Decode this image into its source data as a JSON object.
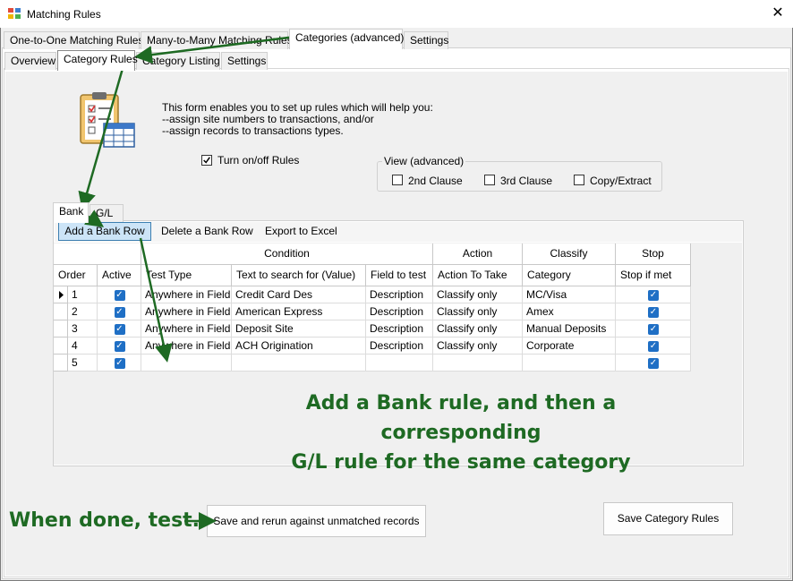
{
  "window": {
    "title": "Matching Rules",
    "close_glyph": "✕"
  },
  "main_tabs": [
    "One-to-One Matching Rules",
    "Many-to-Many Matching Rules",
    "Categories (advanced)",
    "Settings"
  ],
  "sub_tabs": [
    "Overview",
    "Category Rules",
    "Category Listing",
    "Settings"
  ],
  "intro": {
    "line1": "This form enables you to set up rules which will help you:",
    "line2": "--assign site numbers to transactions, and/or",
    "line3": "--assign records to transactions types."
  },
  "turn_onoff": {
    "label": "Turn on/off Rules",
    "checked": true
  },
  "view_adv": {
    "legend": "View (advanced)",
    "options": [
      "2nd Clause",
      "3rd Clause",
      "Copy/Extract"
    ]
  },
  "grid_tabs": [
    "Bank",
    "G/L"
  ],
  "toolbar": {
    "add": "Add a Bank Row",
    "delete": "Delete a Bank Row",
    "export": "Export to Excel"
  },
  "group_headers": {
    "condition": "Condition",
    "action": "Action",
    "classify": "Classify",
    "stop": "Stop"
  },
  "columns": [
    "Order",
    "Active",
    "Test Type",
    "Text to search for (Value)",
    "Field to test",
    "Action To Take",
    "Category",
    "Stop if met"
  ],
  "rows": [
    {
      "order": "1",
      "test": "Anywhere in Field",
      "text": "Credit Card Des",
      "field": "Description",
      "action": "Classify only",
      "category": "MC/Visa"
    },
    {
      "order": "2",
      "test": "Anywhere in Field",
      "text": "American Express",
      "field": "Description",
      "action": "Classify only",
      "category": "Amex"
    },
    {
      "order": "3",
      "test": "Anywhere in Field",
      "text": "Deposit Site",
      "field": "Description",
      "action": "Classify only",
      "category": "Manual Deposits"
    },
    {
      "order": "4",
      "test": "Anywhere in Field",
      "text": "ACH Origination",
      "field": "Description",
      "action": "Classify only",
      "category": "Corporate"
    },
    {
      "order": "5",
      "test": "",
      "text": "",
      "field": "",
      "action": "",
      "category": ""
    }
  ],
  "annotation": {
    "line1": "Add a Bank rule, and then a corresponding",
    "line2": "G/L rule  for the same category",
    "done": "When done, test."
  },
  "buttons": {
    "save_rerun": "Save and rerun against unmatched records",
    "save_rules": "Save Category Rules"
  },
  "colors": {
    "annotation": "#1e6a23",
    "check": "#1f6fc5",
    "selected_button": "#cce4f7"
  }
}
